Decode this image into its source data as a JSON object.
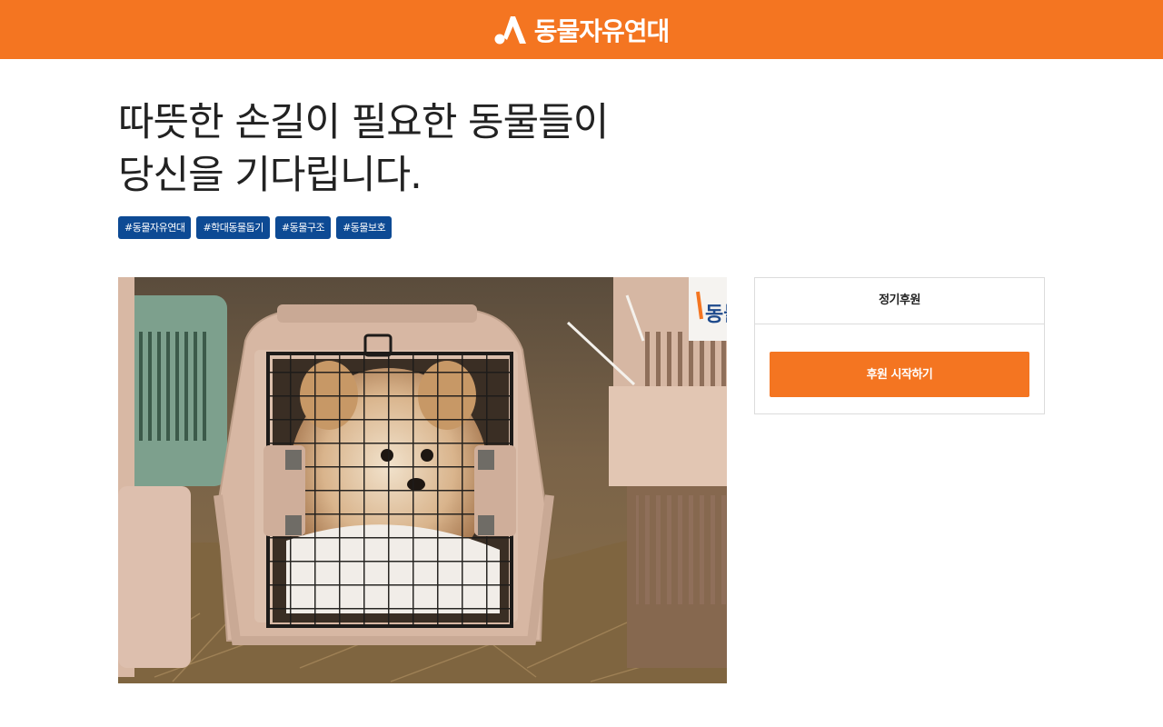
{
  "header": {
    "logo_text": "동물자유연대",
    "logo_icon": "org-logo-mark-icon",
    "background_color": "#f47521"
  },
  "main": {
    "headline_line1": "따뜻한 손길이 필요한 동물들이",
    "headline_line2": "당신을 기다립니다.",
    "tags": [
      "#동물자유연대",
      "#학대동물돕기",
      "#동물구조",
      "#동물보호"
    ],
    "tag_color": "#0d4a94",
    "photo": {
      "subject": "small fluffy dog inside a beige pet carrier on straw",
      "carrier_label": "동물"
    }
  },
  "donation": {
    "heading": "정기후원",
    "button_label": "후원 시작하기",
    "accent_color": "#f47521"
  }
}
